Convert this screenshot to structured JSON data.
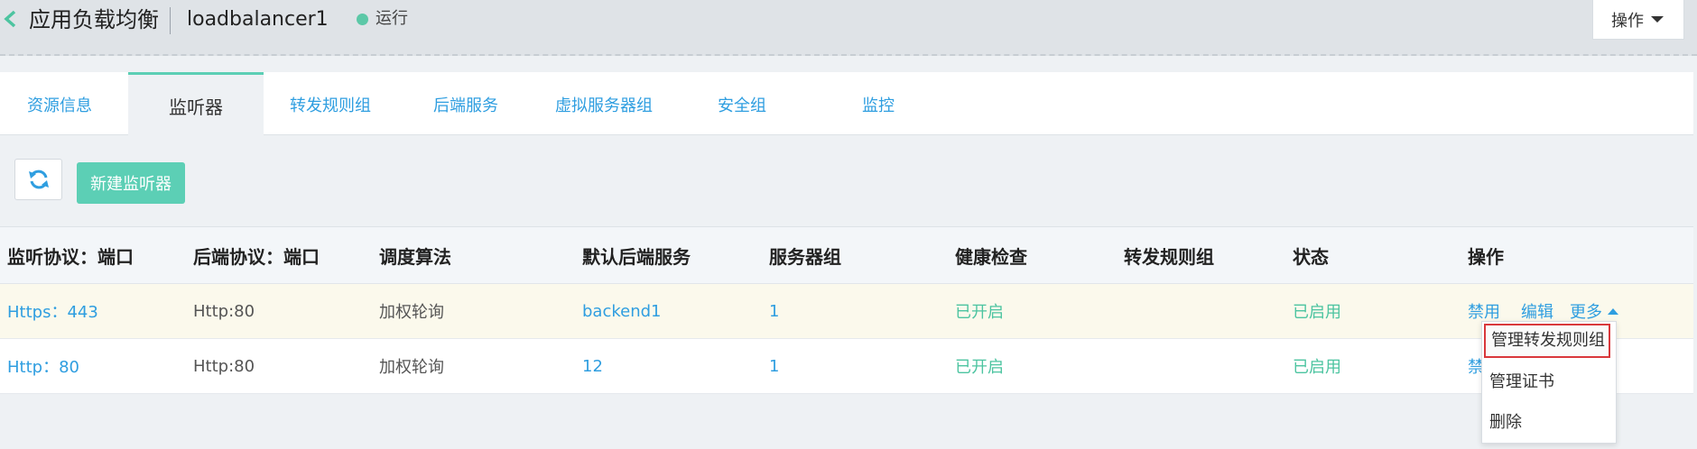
{
  "header": {
    "app_title": "应用负载均衡",
    "lb_name": "loadbalancer1",
    "status": "运行",
    "status_color": "#5cc8a7",
    "ops_label": "操作"
  },
  "tabs": [
    {
      "label": "资源信息"
    },
    {
      "label": "监听器"
    },
    {
      "label": "转发规则组"
    },
    {
      "label": "后端服务"
    },
    {
      "label": "虚拟服务器组"
    },
    {
      "label": "安全组"
    },
    {
      "label": "监控"
    }
  ],
  "toolbar": {
    "refresh_icon": "refresh-icon",
    "new_label": "新建监听器",
    "accent": "#5ccfb5"
  },
  "table": {
    "headers": [
      "监听协议：端口",
      "后端协议：端口",
      "调度算法",
      "默认后端服务",
      "服务器组",
      "健康检查",
      "转发规则组",
      "状态",
      "操作"
    ],
    "rows": [
      {
        "listen": "Https：443",
        "backend_proto": "Http:80",
        "algorithm": "加权轮询",
        "default_backend": "backend1",
        "server_group": "1",
        "health": "已开启",
        "rule_group": "",
        "status": "已启用",
        "action_disable": "禁用",
        "action_edit": "编辑",
        "action_more": "更多"
      },
      {
        "listen": "Http：80",
        "backend_proto": "Http:80",
        "algorithm": "加权轮询",
        "default_backend": "12",
        "server_group": "1",
        "health": "已开启",
        "rule_group": "",
        "status": "已启用",
        "action_disable": "禁"
      }
    ]
  },
  "dropdown": {
    "items": [
      "管理转发规则组",
      "管理证书",
      "删除"
    ]
  }
}
